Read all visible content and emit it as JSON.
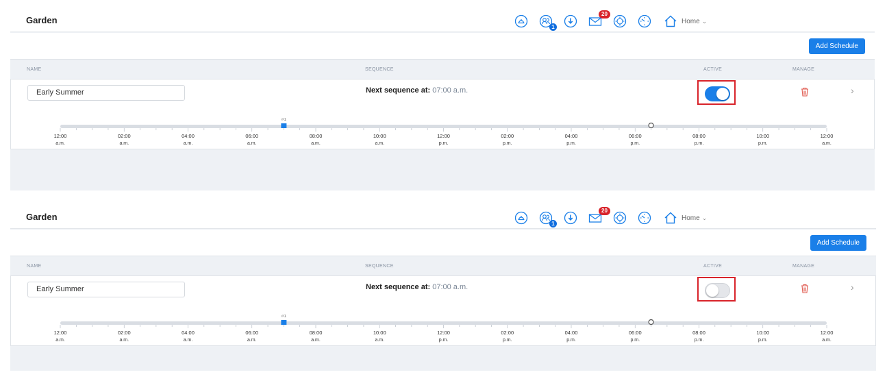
{
  "app": {
    "title": "Garden",
    "home_label": "Home"
  },
  "header": {
    "users_badge": "1",
    "mail_badge": "20",
    "icons": [
      "dashboard-icon",
      "users-icon",
      "download-icon",
      "mail-icon",
      "target-icon",
      "timer-icon",
      "home-icon"
    ]
  },
  "toolbar": {
    "add_schedule_label": "Add Schedule"
  },
  "columns": {
    "name": "NAME",
    "sequence": "SEQUENCE",
    "active": "ACTIVE",
    "manage": "MANAGE"
  },
  "schedule": {
    "name": "Early Summer",
    "next_label": "Next sequence at:",
    "next_time": "07:00 a.m.",
    "marker_label": "#1",
    "marker_hour": 7,
    "now_hour": 18.5
  },
  "timeline": {
    "ticks": [
      {
        "hour": 0,
        "time": "12:00",
        "period": "a.m."
      },
      {
        "hour": 2,
        "time": "02:00",
        "period": "a.m."
      },
      {
        "hour": 4,
        "time": "04:00",
        "period": "a.m."
      },
      {
        "hour": 6,
        "time": "06:00",
        "period": "a.m."
      },
      {
        "hour": 8,
        "time": "08:00",
        "period": "a.m."
      },
      {
        "hour": 10,
        "time": "10:00",
        "period": "a.m."
      },
      {
        "hour": 12,
        "time": "12:00",
        "period": "p.m."
      },
      {
        "hour": 14,
        "time": "02:00",
        "period": "p.m."
      },
      {
        "hour": 16,
        "time": "04:00",
        "period": "p.m."
      },
      {
        "hour": 18,
        "time": "06:00",
        "period": "p.m."
      },
      {
        "hour": 20,
        "time": "08:00",
        "period": "p.m."
      },
      {
        "hour": 22,
        "time": "10:00",
        "period": "p.m."
      },
      {
        "hour": 24,
        "time": "12:00",
        "period": "a.m."
      }
    ]
  },
  "panels": [
    {
      "active": true
    },
    {
      "active": false
    }
  ],
  "colors": {
    "accent": "#1a7fe8",
    "highlight": "#d8232a",
    "trash": "#e05a4f"
  }
}
